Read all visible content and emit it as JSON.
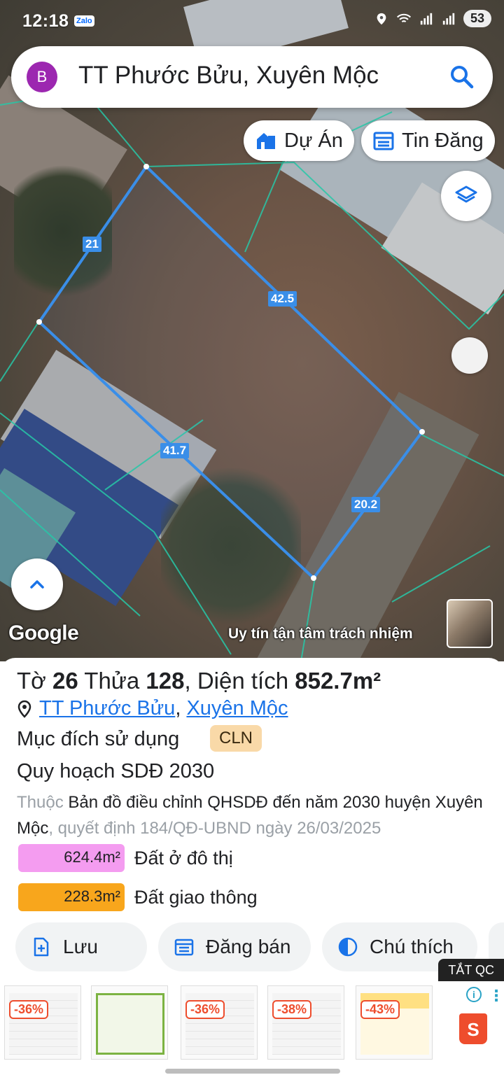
{
  "status_bar": {
    "time": "12:18",
    "app_badge": "Zalo",
    "battery": "53"
  },
  "search": {
    "avatar_letter": "B",
    "query": "TT Phước Bửu, Xuyên Mộc"
  },
  "map_chips": {
    "projects": "Dự Án",
    "listings": "Tin Đăng"
  },
  "parcel": {
    "edge_labels": {
      "top_left": "21",
      "top_right": "42.5",
      "bottom_left": "41.7",
      "bottom_right": "20.2"
    }
  },
  "map_footer": {
    "logo": "Google",
    "slogan": "Uy tín tận tâm trách nhiệm"
  },
  "info": {
    "sheet_label": "Tờ",
    "sheet_no": "26",
    "lot_label": "Thửa",
    "lot_no": "128",
    "area_label": ", Diện tích",
    "area_value": "852.7m²",
    "location_commune": "TT Phước Bửu",
    "location_sep": ",",
    "location_district": "Xuyên Mộc",
    "purpose_label": "Mục đích sử dụng",
    "purpose_code": "CLN",
    "plan_title": "Quy hoạch SDĐ 2030",
    "plan_prefix": "Thuộc",
    "plan_map": "Bản đồ điều chỉnh QHSDĐ đến năm 2030 huyện Xuyên Mộc",
    "plan_decision": ", quyết định 184/QĐ-UBND ngày 26/03/2025",
    "zones": [
      {
        "area": "624.4m²",
        "label": "Đất ở đô thị",
        "color": "#f49cf0"
      },
      {
        "area": "228.3m²",
        "label": "Đất giao thông",
        "color": "#f8a61c"
      }
    ]
  },
  "actions": {
    "save": "Lưu",
    "post": "Đăng bán",
    "legend": "Chú thích"
  },
  "ad": {
    "close_label": "TẮT QC",
    "items": [
      {
        "discount": "-36%"
      },
      {
        "discount": ""
      },
      {
        "discount": "-36%"
      },
      {
        "discount": "-38%"
      },
      {
        "discount": "-43%"
      }
    ],
    "shop_logo": "S",
    "info_icon": "i"
  }
}
